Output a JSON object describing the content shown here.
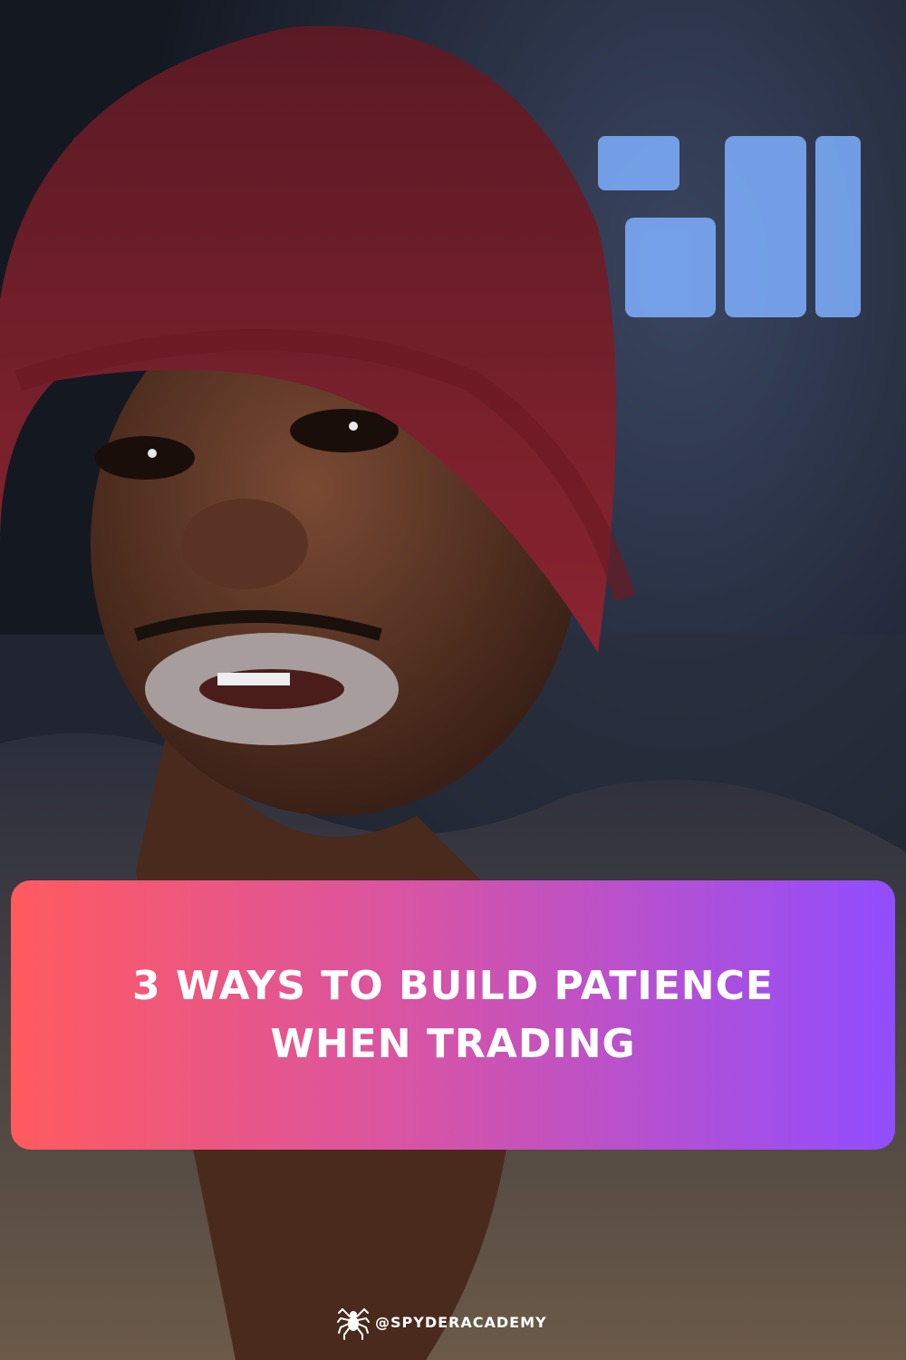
{
  "banner": {
    "line1": "3 WAYS TO BUILD PATIENCE",
    "line2": "WHEN TRADING"
  },
  "brand": {
    "handle": "@SPYDERACADEMY",
    "icon": "spider-icon"
  },
  "colors": {
    "banner_gradient_start": "#ff5a5f",
    "banner_gradient_mid": "#d854a4",
    "banner_gradient_end": "#914dff",
    "text": "#ffffff"
  }
}
